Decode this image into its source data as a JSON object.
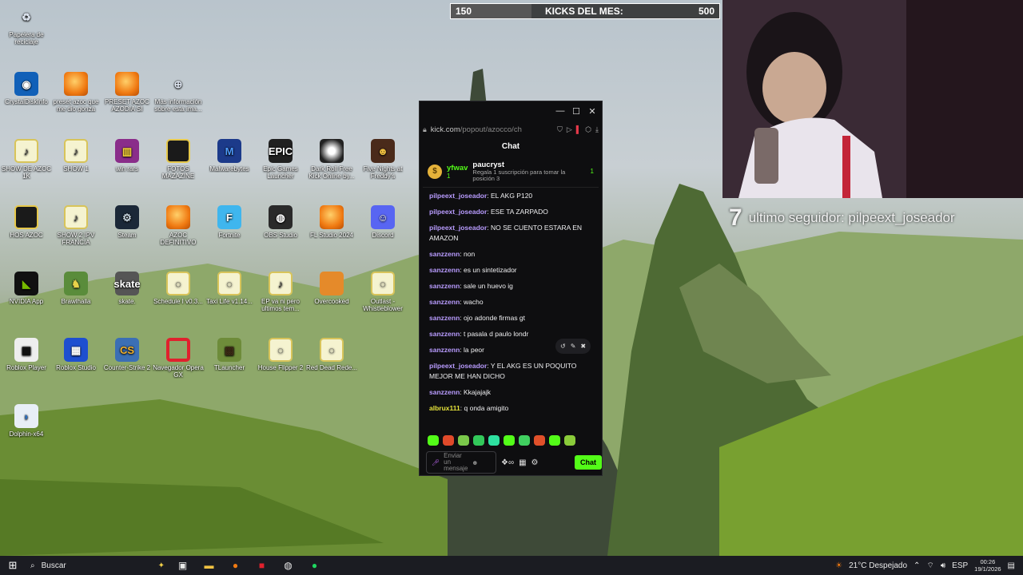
{
  "kicks": {
    "current": "150",
    "title": "KICKS DEL MES:",
    "goal": "500",
    "progress": 0.3
  },
  "follower": {
    "number": "7",
    "text": "ultimo seguidor: pilpeext_joseador"
  },
  "desktop_icons": [
    {
      "label": "Papelera de reciclaje",
      "icon": "recycle-bin-icon",
      "glyph": "♻"
    },
    {
      "label": "CrystalDiskInfo",
      "icon": "crystaldiskinfo-icon",
      "glyph": "◉"
    },
    {
      "label": "preset azoc que me dio gonza",
      "icon": "fl-studio-icon",
      "glyph": ""
    },
    {
      "label": "PRESET AZOC AZODIA SI",
      "icon": "fl-studio-icon",
      "glyph": ""
    },
    {
      "label": "Más información sobre esta ima...",
      "icon": "info-icon",
      "glyph": "⊕"
    },
    {
      "label": "SHOW DE AZOC 1K",
      "icon": "file-icon",
      "glyph": "♪"
    },
    {
      "label": "SHOW 1",
      "icon": "file-icon",
      "glyph": "♪"
    },
    {
      "label": "win rars",
      "icon": "winrar-icon",
      "glyph": "▥"
    },
    {
      "label": "FOTOS MAZAZINE",
      "icon": "folder-icon",
      "glyph": ""
    },
    {
      "label": "Malwarebytes",
      "icon": "malwarebytes-icon",
      "glyph": "M"
    },
    {
      "label": "Epic Games Launcher",
      "icon": "epic-games-icon",
      "glyph": "EPIC"
    },
    {
      "label": "Dark Roll Free Kick Online by...",
      "icon": "football-icon",
      "glyph": ""
    },
    {
      "label": "Five Nights at Freddy's",
      "icon": "fnaf-icon",
      "glyph": "☻"
    },
    {
      "label": "HOS AZOC",
      "icon": "folder-icon",
      "glyph": ""
    },
    {
      "label": "SHOW 2 IPV FRANCIA",
      "icon": "file-icon",
      "glyph": "♪"
    },
    {
      "label": "Steam",
      "icon": "steam-icon",
      "glyph": "⚙"
    },
    {
      "label": "AZOC DEFINITIVO",
      "icon": "fl-studio-icon",
      "glyph": ""
    },
    {
      "label": "Fortnite",
      "icon": "fortnite-icon",
      "glyph": "F"
    },
    {
      "label": "OBS Studio",
      "icon": "obs-icon",
      "glyph": "◍"
    },
    {
      "label": "FL Studio 2024",
      "icon": "fl-studio-icon",
      "glyph": ""
    },
    {
      "label": "Discord",
      "icon": "discord-icon",
      "glyph": "☺"
    },
    {
      "label": "NVIDIA App",
      "icon": "nvidia-icon",
      "glyph": "◣"
    },
    {
      "label": "Brawlhalla",
      "icon": "brawlhalla-icon",
      "glyph": "♞"
    },
    {
      "label": "skate.",
      "icon": "skate-icon",
      "glyph": "skate"
    },
    {
      "label": "Schedule I v0.3...",
      "icon": "file-icon",
      "glyph": "◌"
    },
    {
      "label": "Taxi Life v1.14...",
      "icon": "file-icon",
      "glyph": "◌"
    },
    {
      "label": "EP va ni pero ultimos tem...",
      "icon": "file-icon",
      "glyph": "♪"
    },
    {
      "label": "Overcooked",
      "icon": "overcooked-icon",
      "glyph": ""
    },
    {
      "label": "Outlast - Whistleblower",
      "icon": "file-icon",
      "glyph": "◌"
    },
    {
      "label": "Roblox Player",
      "icon": "roblox-icon",
      "glyph": "▣"
    },
    {
      "label": "Roblox Studio",
      "icon": "roblox-studio-icon",
      "glyph": "▦"
    },
    {
      "label": "Counter-Strike 2",
      "icon": "counter-strike-icon",
      "glyph": "CS"
    },
    {
      "label": "Navegador Opera GX",
      "icon": "opera-gx-icon",
      "glyph": ""
    },
    {
      "label": "TLauncher",
      "icon": "minecraft-icon",
      "glyph": "▩"
    },
    {
      "label": "House Flipper 2",
      "icon": "file-icon",
      "glyph": "◌"
    },
    {
      "label": "Red Dead Rede...",
      "icon": "file-icon",
      "glyph": "◌"
    },
    {
      "label": "Dolphin-x64",
      "icon": "dolphin-icon",
      "glyph": "◗"
    }
  ],
  "chat": {
    "url_host": "kick.com",
    "url_path": "/popout/azocco/ch",
    "title": "Chat",
    "pinned": {
      "user1": "yfwav",
      "count1": "1",
      "user2": "paucryst",
      "count2": "1",
      "subtext": "Regala 1 suscripción para tomar la posición 3"
    },
    "messages": [
      {
        "user": "pilpeext_joseador",
        "text": "EL AKG P120",
        "color": "#b99cff"
      },
      {
        "user": "pilpeext_joseador",
        "text": "ESE TA ZARPADO",
        "color": "#b99cff"
      },
      {
        "user": "pilpeext_joseador",
        "text": "NO SE CUENTO ESTARA EN AMAZON",
        "color": "#b99cff"
      },
      {
        "user": "sanzzenn",
        "text": "non",
        "color": "#b99cff"
      },
      {
        "user": "sanzzenn",
        "text": "es un sintetizador",
        "color": "#b99cff"
      },
      {
        "user": "sanzzenn",
        "text": "sale un huevo ig",
        "color": "#b99cff"
      },
      {
        "user": "sanzzenn",
        "text": "wacho",
        "color": "#b99cff"
      },
      {
        "user": "sanzzenn",
        "text": "ojo adonde firmas gt",
        "color": "#b99cff"
      },
      {
        "user": "sanzzenn",
        "text": "t pasala d paulo londr",
        "color": "#b99cff"
      },
      {
        "user": "sanzzenn",
        "text": "la peor",
        "color": "#b99cff"
      },
      {
        "user": "pilpeext_joseador",
        "text": "Y EL AKG ES UN POQUITO MEJOR ME HAN DICHO",
        "color": "#b99cff"
      },
      {
        "user": "sanzzenn",
        "text": "Kkajajajk",
        "color": "#b99cff"
      },
      {
        "user": "albrux111",
        "text": "q onda amigito",
        "color": "#e6e33b"
      }
    ],
    "input_placeholder": "Enviar un mensaje",
    "send_label": "Chat",
    "accent": "#53fc18"
  },
  "taskbar": {
    "search_placeholder": "Buscar",
    "weather": "21°C Despejado",
    "language": "ESP",
    "time": "00:26",
    "date": "19/1/2026"
  }
}
